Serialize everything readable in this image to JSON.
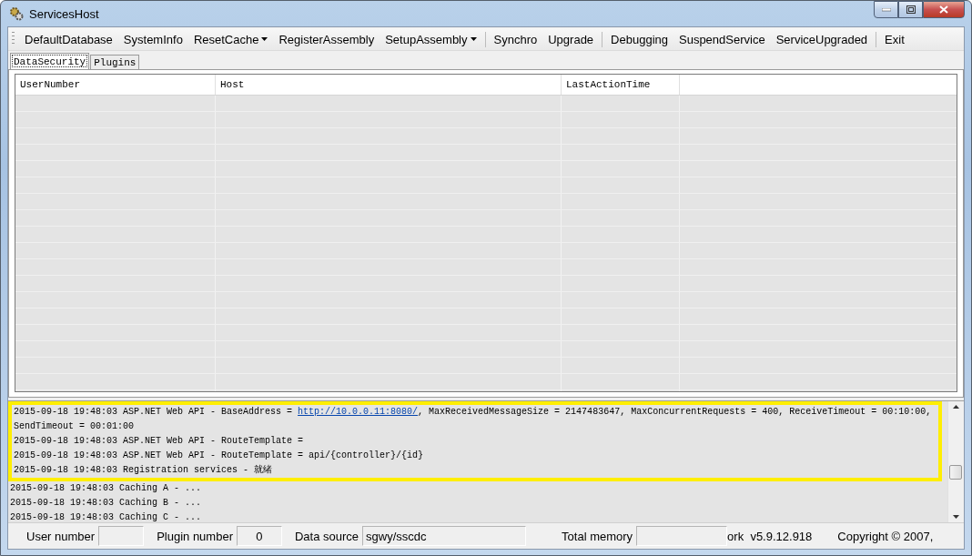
{
  "window": {
    "title": "ServicesHost"
  },
  "toolbar": [
    {
      "label": "DefaultDatabase",
      "kind": "button"
    },
    {
      "label": "SystemInfo",
      "kind": "button"
    },
    {
      "label": "ResetCache",
      "kind": "dropdown"
    },
    {
      "label": "RegisterAssembly",
      "kind": "button"
    },
    {
      "label": "SetupAssembly",
      "kind": "dropdown"
    },
    {
      "kind": "separator"
    },
    {
      "label": "Synchro",
      "kind": "button"
    },
    {
      "label": "Upgrade",
      "kind": "button"
    },
    {
      "kind": "separator"
    },
    {
      "label": "Debugging",
      "kind": "button"
    },
    {
      "label": "SuspendService",
      "kind": "button"
    },
    {
      "label": "ServiceUpgraded",
      "kind": "button"
    },
    {
      "kind": "separator"
    },
    {
      "label": "Exit",
      "kind": "button"
    }
  ],
  "tabs": [
    {
      "label": "DataSecurity",
      "selected": true
    },
    {
      "label": "Plugins",
      "selected": false
    }
  ],
  "table": {
    "columns": [
      "UserNumber",
      "Host",
      "LastActionTime"
    ]
  },
  "log": {
    "highlighted_lines": [
      {
        "text": "2015-09-18 19:48:03 ASP.NET Web API - BaseAddress = ",
        "link": "http://10.0.0.11:8080/",
        "after": ", MaxReceivedMessageSize = 2147483647, MaxConcurrentRequests = 400, ReceiveTimeout = 00:10:00,"
      },
      {
        "text": "SendTimeout = 00:01:00"
      },
      {
        "text": "2015-09-18 19:48:03 ASP.NET Web API - RouteTemplate ="
      },
      {
        "text": "2015-09-18 19:48:03 ASP.NET Web API - RouteTemplate = api/{controller}/{id}"
      },
      {
        "text": "2015-09-18 19:48:03 Registration services - 就绪"
      }
    ],
    "lines": [
      {
        "text": "2015-09-18 19:48:03 Caching A  - ..."
      },
      {
        "text": "2015-09-18 19:48:03 Caching B  - ..."
      },
      {
        "text": "2015-09-18 19:48:03 Caching C  - ..."
      }
    ]
  },
  "status_bar": {
    "fields": [
      {
        "label": "User number"
      },
      {
        "label": "Plugin number",
        "value": "0"
      },
      {
        "label": "Data source",
        "value": "sgwy/sscdc"
      },
      {
        "label": "Total memory"
      }
    ],
    "version": "ork  v5.9.12.918",
    "copyright": "Copyright © 2007,"
  }
}
